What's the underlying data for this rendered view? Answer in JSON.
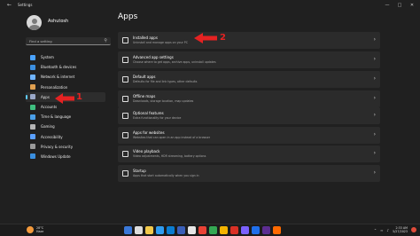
{
  "window": {
    "title": "Settings"
  },
  "user": {
    "name": "Ashutosh"
  },
  "search": {
    "placeholder": "Find a setting"
  },
  "sidebar": {
    "items": [
      {
        "label": "System",
        "color": "#4aa3ff"
      },
      {
        "label": "Bluetooth & devices",
        "color": "#3c8fe0"
      },
      {
        "label": "Network & internet",
        "color": "#6fb4ff"
      },
      {
        "label": "Personalization",
        "color": "#e0a050"
      },
      {
        "label": "Apps",
        "color": "#9aa8c8",
        "active": true
      },
      {
        "label": "Accounts",
        "color": "#3fbf7f"
      },
      {
        "label": "Time & language",
        "color": "#4a9fe8"
      },
      {
        "label": "Gaming",
        "color": "#b5b5b5"
      },
      {
        "label": "Accessibility",
        "color": "#5aa0ff"
      },
      {
        "label": "Privacy & security",
        "color": "#9a9a9a"
      },
      {
        "label": "Windows Update",
        "color": "#3a8fe0"
      }
    ]
  },
  "main": {
    "title": "Apps",
    "cards": [
      {
        "title": "Installed apps",
        "subtitle": "Uninstall and manage apps on your PC"
      },
      {
        "title": "Advanced app settings",
        "subtitle": "Choose where to get apps, archive apps, uninstall updates"
      },
      {
        "title": "Default apps",
        "subtitle": "Defaults for file and link types, other defaults"
      },
      {
        "title": "Offline maps",
        "subtitle": "Downloads, storage location, map updates"
      },
      {
        "title": "Optional features",
        "subtitle": "Extra functionality for your device"
      },
      {
        "title": "Apps for websites",
        "subtitle": "Websites that can open in an app instead of a browser"
      },
      {
        "title": "Video playback",
        "subtitle": "Video adjustments, HDR streaming, battery options"
      },
      {
        "title": "Startup",
        "subtitle": "Apps that start automatically when you sign in"
      }
    ]
  },
  "annotations": {
    "arrow1": "1",
    "arrow2": "2",
    "color": "#e52222"
  },
  "taskbar": {
    "weather_temp": "28°C",
    "weather_desc": "Haze",
    "time": "2:33 AM",
    "date": "5/27/2023",
    "pinned_colors": [
      "#3a78d8",
      "#dddddd",
      "#f2c94c",
      "#2f9cf0",
      "#0a7cd0",
      "#3a5fb8",
      "#e6e6e6",
      "#e94235",
      "#34a853",
      "#f4b400",
      "#d93025",
      "#7b61ff",
      "#1f6feb",
      "#5c2d91",
      "#ff6a00"
    ]
  }
}
